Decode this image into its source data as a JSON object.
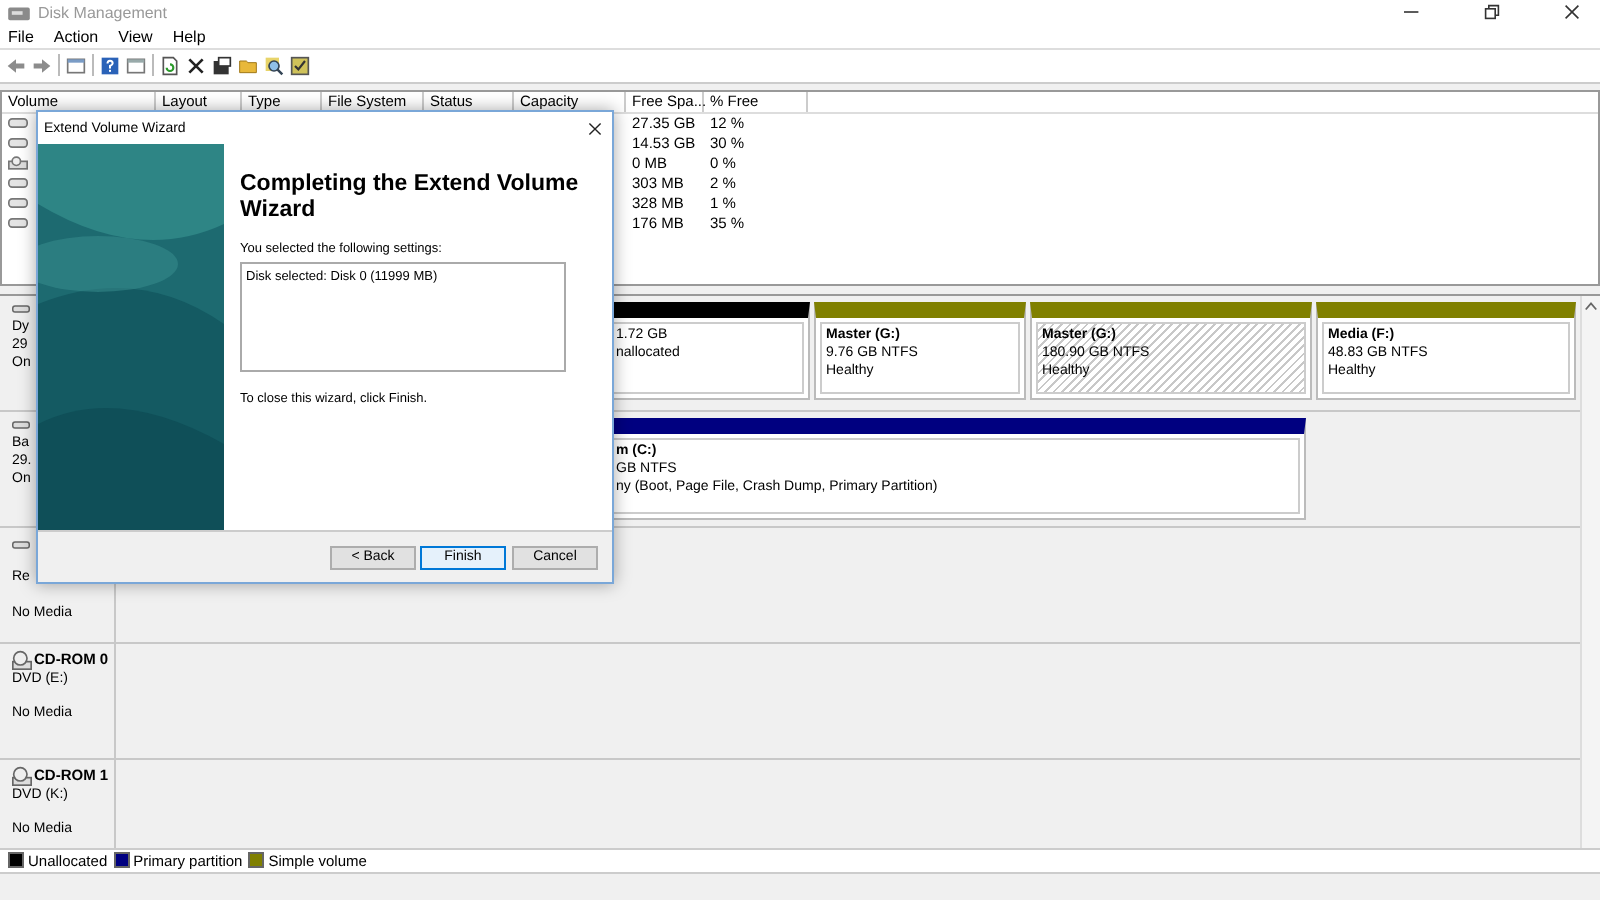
{
  "window": {
    "title": "Disk Management"
  },
  "menu": [
    "File",
    "Action",
    "View",
    "Help"
  ],
  "columns": [
    "Volume",
    "Layout",
    "Type",
    "File System",
    "Status",
    "Capacity",
    "Free Spa...",
    "% Free"
  ],
  "volume_rows": [
    {
      "kind": "disk",
      "free_space": "27.35 GB",
      "percent_free": "12 %"
    },
    {
      "kind": "disk",
      "free_space": "14.53 GB",
      "percent_free": "30 %"
    },
    {
      "kind": "cdrom",
      "free_space": "0 MB",
      "percent_free": "0 %"
    },
    {
      "kind": "disk",
      "free_space": "303 MB",
      "percent_free": "2 %"
    },
    {
      "kind": "disk",
      "free_space": "328 MB",
      "percent_free": "1 %"
    },
    {
      "kind": "disk",
      "free_space": "176 MB",
      "percent_free": "35 %"
    }
  ],
  "disks": [
    {
      "kind": "disk",
      "lines": [
        "Dy",
        "29",
        "On"
      ],
      "partitions": [
        {
          "color": "#000000",
          "selected": false,
          "lines": [
            "1.72 GB",
            "nallocated"
          ]
        },
        {
          "color": "#808000",
          "selected": false,
          "title": "Master  (G:)",
          "lines": [
            "9.76 GB NTFS",
            "Healthy"
          ]
        },
        {
          "color": "#808000",
          "selected": true,
          "title": "Master  (G:)",
          "lines": [
            "180.90 GB NTFS",
            "Healthy"
          ]
        },
        {
          "color": "#808000",
          "selected": false,
          "title": "Media  (F:)",
          "lines": [
            "48.83 GB NTFS",
            "Healthy"
          ]
        }
      ]
    },
    {
      "kind": "disk",
      "lines": [
        "Ba",
        "29.",
        "On"
      ],
      "partitions": [
        {
          "color": "#000080",
          "selected": false,
          "title": "m  (C:)",
          "lines": [
            "GB NTFS",
            "ny (Boot, Page File, Crash Dump, Primary Partition)"
          ]
        }
      ]
    },
    {
      "kind": "disk",
      "lines": [
        "Re",
        "No Media"
      ]
    },
    {
      "kind": "cdrom",
      "name": "CD-ROM 0",
      "lines": [
        "DVD (E:)",
        "No Media"
      ]
    },
    {
      "kind": "cdrom",
      "name": "CD-ROM 1",
      "lines": [
        "DVD (K:)",
        "No Media"
      ]
    }
  ],
  "legend": [
    {
      "label": "Unallocated",
      "color": "#000000"
    },
    {
      "label": "Primary partition",
      "color": "#000080"
    },
    {
      "label": "Simple volume",
      "color": "#808000"
    }
  ],
  "dialog": {
    "title": "Extend Volume Wizard",
    "heading": "Completing the Extend Volume Wizard",
    "intro": "You selected the following settings:",
    "settings": "Disk selected: Disk 0 (11999 MB)",
    "closing": "To close this wizard, click Finish.",
    "buttons": [
      {
        "label": "< Back",
        "selected": false
      },
      {
        "label": "Finish",
        "selected": true
      },
      {
        "label": "Cancel",
        "selected": false
      }
    ]
  }
}
